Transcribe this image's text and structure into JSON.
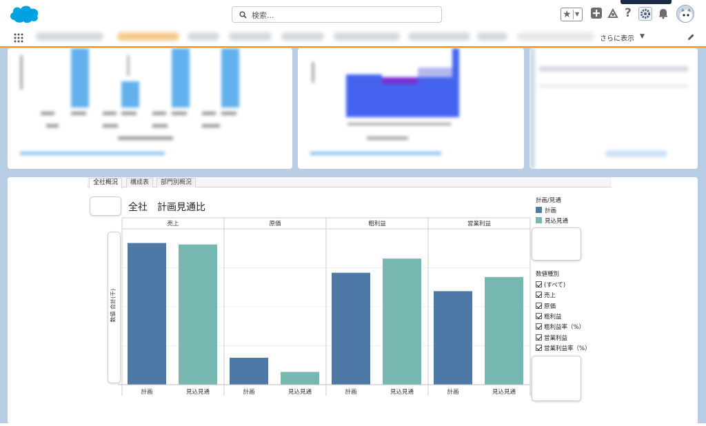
{
  "header": {
    "search_placeholder": "検索...",
    "brand_color": "#00a1e0"
  },
  "nav": {
    "more_label": "さらに表示",
    "accent": "#f39c12"
  },
  "main": {
    "tabs": [
      {
        "label": "全社概況",
        "active": true
      },
      {
        "label": "構成表",
        "active": false
      },
      {
        "label": "部門別概況",
        "active": false
      }
    ],
    "title": "全社　計画見通比",
    "legend1": {
      "title": "計画/見通",
      "items": [
        {
          "label": "計画",
          "color": "#4e79a7"
        },
        {
          "label": "見込見通",
          "color": "#76b7b2"
        }
      ]
    },
    "legend2": {
      "title": "数値種別",
      "items": [
        "(すべて)",
        "売上",
        "原価",
        "粗利益",
        "粗利益率（%）",
        "営業利益",
        "営業利益率（%）"
      ]
    }
  },
  "chart_data": {
    "type": "bar",
    "ylabel": "数値 合計(千)",
    "panels": [
      "売上",
      "原価",
      "粗利益",
      "営業利益"
    ],
    "categories": [
      "計画",
      "見込見通"
    ],
    "colors": [
      "#4e79a7",
      "#76b7b2"
    ],
    "values": [
      [
        100,
        99
      ],
      [
        19,
        9
      ],
      [
        79,
        89
      ],
      [
        66,
        76
      ]
    ],
    "ylim": [
      0,
      110
    ]
  }
}
